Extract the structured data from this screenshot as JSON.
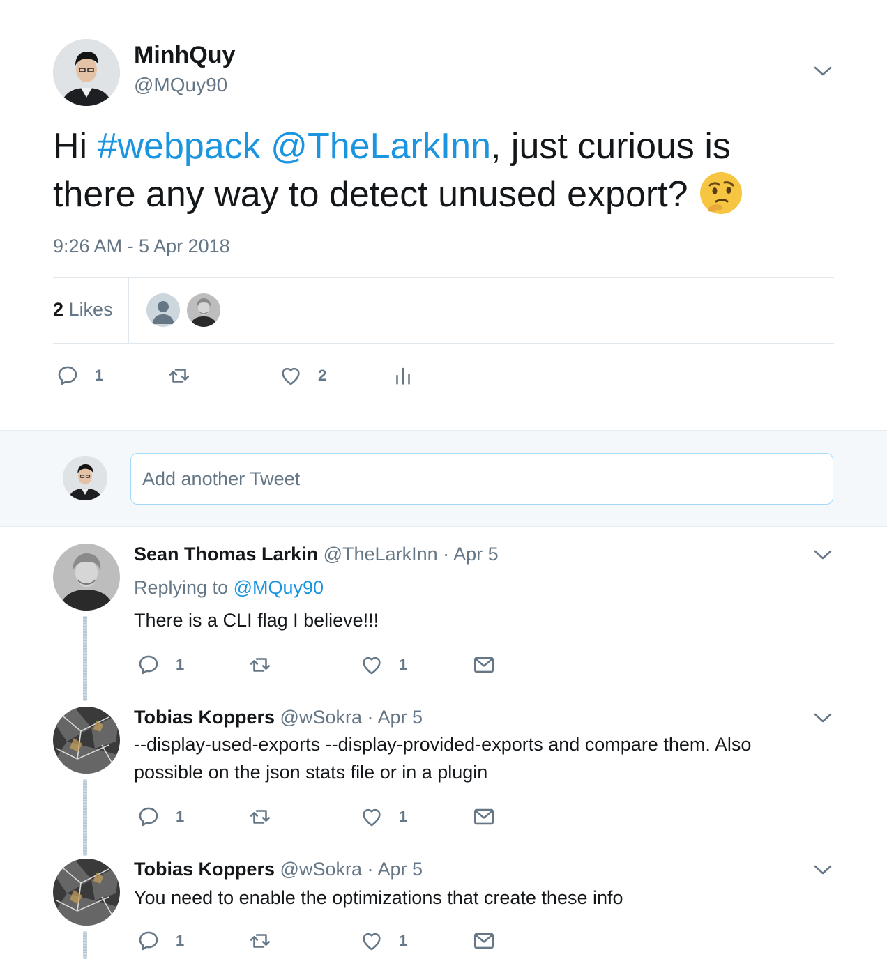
{
  "main_tweet": {
    "author_name": "MinhQuy",
    "author_handle": "@MQuy90",
    "text_start": "Hi ",
    "hashtag": "#webpack",
    "mention": "@TheLarkInn",
    "text_end": ", just curious is there any way to detect unused export?",
    "emoji": "thinking-face",
    "timestamp": "9:26 AM - 5 Apr 2018",
    "likes_number": "2",
    "likes_label": "Likes",
    "actions": {
      "reply_count": "1",
      "retweet_count": "",
      "like_count": "2"
    }
  },
  "compose": {
    "placeholder": "Add another Tweet"
  },
  "replies": [
    {
      "name": "Sean Thomas Larkin",
      "handle": "@TheLarkInn",
      "date": "· Apr 5",
      "replying_label": "Replying to",
      "replying_to": "@MQuy90",
      "text": "There is a CLI flag I believe!!!",
      "reply_count": "1",
      "like_count": "1"
    },
    {
      "name": "Tobias Koppers",
      "handle": "@wSokra",
      "date": "· Apr 5",
      "text": "--display-used-exports --display-provided-exports and compare them. Also possible on the json stats file or in a plugin",
      "reply_count": "1",
      "like_count": "1"
    },
    {
      "name": "Tobias Koppers",
      "handle": "@wSokra",
      "date": "· Apr 5",
      "text": "You need to enable the optimizations that create these info",
      "reply_count": "1",
      "like_count": "1"
    }
  ],
  "colors": {
    "link": "#1b95e0",
    "secondary_text": "#657786",
    "primary_text": "#14171a",
    "divider": "#e1e8ed"
  }
}
